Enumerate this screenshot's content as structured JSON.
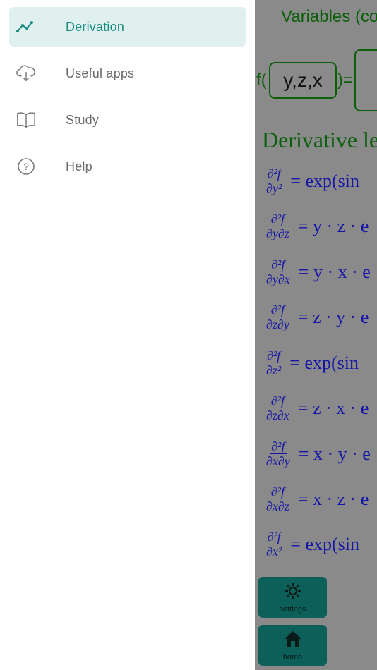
{
  "drawer": {
    "items": [
      {
        "label": "Derivation",
        "icon": "chart-line-icon",
        "active": true
      },
      {
        "label": "Useful apps",
        "icon": "cloud-download-icon",
        "active": false
      },
      {
        "label": "Study",
        "icon": "book-icon",
        "active": false
      },
      {
        "label": "Help",
        "icon": "help-circle-icon",
        "active": false
      }
    ]
  },
  "background": {
    "variables_title": "Variables (co",
    "f_prefix": "f(",
    "variables_value": "y,z,x",
    "equals": ")=",
    "derivative_title": "Derivative le",
    "equations": [
      {
        "num": "∂²f",
        "den": "∂y²",
        "rhs": "= exp(sin"
      },
      {
        "num": "∂²f",
        "den": "∂y∂z",
        "rhs": "= y · z · e"
      },
      {
        "num": "∂²f",
        "den": "∂y∂x",
        "rhs": "= y · x · e"
      },
      {
        "num": "∂²f",
        "den": "∂z∂y",
        "rhs": "= z · y · e"
      },
      {
        "num": "∂²f",
        "den": "∂z²",
        "rhs": "= exp(sin"
      },
      {
        "num": "∂²f",
        "den": "∂z∂x",
        "rhs": "= z · x · e"
      },
      {
        "num": "∂²f",
        "den": "∂x∂y",
        "rhs": "= x · y · e"
      },
      {
        "num": "∂²f",
        "den": "∂x∂z",
        "rhs": "= x · z · e"
      },
      {
        "num": "∂²f",
        "den": "∂x²",
        "rhs": "= exp(sin"
      }
    ],
    "settings_label": "settings",
    "home_label": "home"
  },
  "colors": {
    "accent": "#1a8c80",
    "active_bg": "#e0f0ef",
    "equation_blue": "#1515a8",
    "title_green": "#0b5f0b",
    "button_teal": "#0d5f5a"
  }
}
